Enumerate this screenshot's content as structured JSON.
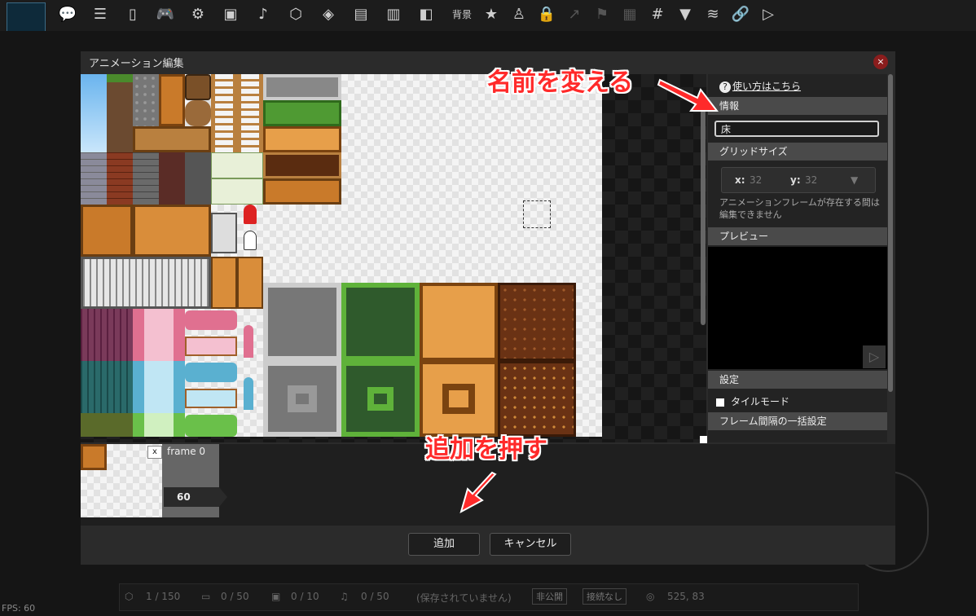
{
  "toolbar": {
    "items": [
      {
        "icon": "chat-bubble-icon",
        "glyph": "💬"
      },
      {
        "icon": "layers-stack-icon",
        "glyph": "☰"
      },
      {
        "icon": "door-icon",
        "glyph": "▯"
      },
      {
        "icon": "gamepad-icon",
        "glyph": "🎮"
      },
      {
        "icon": "gear-icon",
        "glyph": "⚙"
      },
      {
        "icon": "image-icon",
        "glyph": "▣"
      },
      {
        "icon": "music-note-icon",
        "glyph": "♪"
      },
      {
        "icon": "cube-icon",
        "glyph": "⬡"
      },
      {
        "icon": "small-cube-icon",
        "glyph": "◈"
      },
      {
        "icon": "film-strip-icon",
        "glyph": "▤"
      },
      {
        "icon": "save-disk-icon",
        "glyph": "▥"
      },
      {
        "icon": "plugin-icon",
        "glyph": "◧"
      }
    ],
    "background_label": "背景",
    "right_items": [
      {
        "icon": "star-icon",
        "glyph": "★"
      },
      {
        "icon": "person-icon",
        "glyph": "♙"
      },
      {
        "icon": "lock-icon",
        "glyph": "🔒"
      },
      {
        "icon": "graph-icon",
        "glyph": "↗"
      },
      {
        "icon": "flag-icon",
        "glyph": "⚑"
      },
      {
        "icon": "map-icon",
        "glyph": "▦"
      },
      {
        "icon": "grid-icon",
        "glyph": "#"
      },
      {
        "icon": "dropdown-triangle-icon",
        "glyph": "▼"
      },
      {
        "icon": "layers-icon",
        "glyph": "≋"
      },
      {
        "icon": "link-icon",
        "glyph": "🔗"
      },
      {
        "icon": "play-icon",
        "glyph": "▷"
      }
    ]
  },
  "dialog": {
    "title": "アニメーション編集",
    "close_glyph": "×",
    "help_link": "使い方はこちら",
    "help_icon": "?",
    "info_section": "情報",
    "name_value": "床",
    "grid_size_section": "グリッドサイズ",
    "grid_x_label": "x:",
    "grid_x_value": "32",
    "grid_y_label": "y:",
    "grid_y_value": "32",
    "grid_note": "アニメーションフレームが存在する間は編集できません",
    "preview_section": "プレビュー",
    "play_glyph": "▷",
    "settings_section": "設定",
    "tile_mode_label": "タイルモード",
    "frame_interval_section": "フレーム間隔の一括設定",
    "frame": {
      "label": "frame 0",
      "remove_glyph": "x",
      "duration": "60"
    },
    "add_button": "追加",
    "cancel_button": "キャンセル"
  },
  "annotations": {
    "rename": "名前を変える",
    "press_add": "追加を押す"
  },
  "statusbar": {
    "objects": "1 / 150",
    "frames": "0 / 50",
    "images": "0 / 10",
    "sounds": "0 / 50",
    "save_state": "(保存されていません)",
    "visibility": "非公開",
    "connection": "接続なし",
    "coords": "525, 83"
  },
  "fps_label": "FPS: 60",
  "colors": {
    "annotation": "#ff2a2a",
    "close_button": "#8b1d1d",
    "section_header": "#4a4a4a"
  }
}
